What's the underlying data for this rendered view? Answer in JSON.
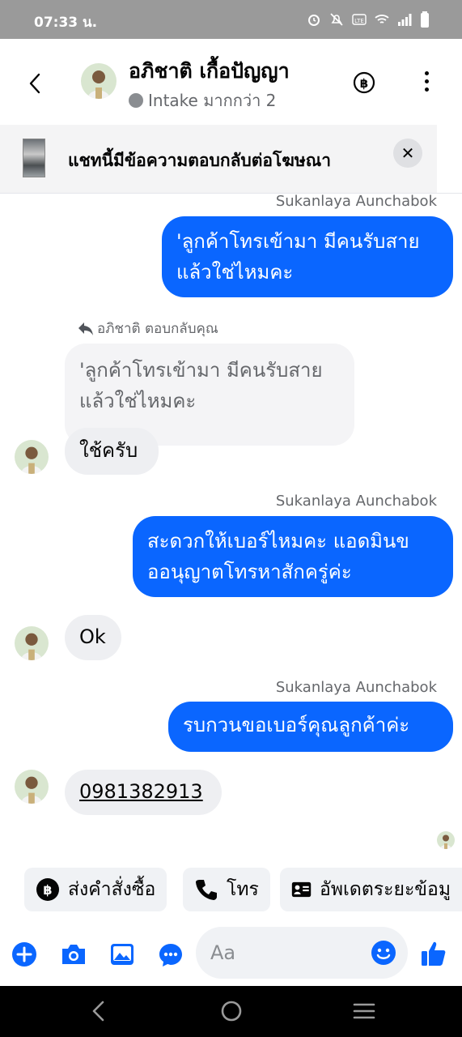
{
  "status_bar": {
    "time": "07:33 น.",
    "icons": [
      "alarm-icon",
      "mute-icon",
      "volte-icon",
      "wifi-icon",
      "signal-icon",
      "battery-icon"
    ]
  },
  "header": {
    "back_icon": "chevron-left-icon",
    "contact_name": "อภิชาติ เกื้อปัญญา",
    "status_text": "Intake มากกว่า 2",
    "payment_icon": "baht-circle-icon",
    "more_icon": "more-vertical-icon"
  },
  "ad_banner": {
    "text": "แชทนี้มีข้อความตอบกลับต่อโฆษณา",
    "close_label": "✕"
  },
  "messages": {
    "out1": {
      "sender": "Sukanlaya Aunchabok",
      "line1": "'ลูกค้าโทรเข้ามา มีคนรับสาย",
      "line2": "แล้วใช่ไหมคะ"
    },
    "reply": {
      "hint": "อภิชาติ ตอบกลับคุณ",
      "quoted_line1": "'ลูกค้าโทรเข้ามา มีคนรับสาย",
      "quoted_line2": "แล้วใช่ไหมคะ",
      "text": "ใช้ครับ"
    },
    "out2": {
      "sender": "Sukanlaya Aunchabok",
      "line1": "สะดวกให้เบอร์ไหมคะ แอดมินข",
      "line2": "ออนุญาตโทรหาสักครู่ค่ะ"
    },
    "in2": {
      "text": "Ok"
    },
    "out3": {
      "sender": "Sukanlaya Aunchabok",
      "text": "รบกวนขอเบอร์คุณลูกค้าค่ะ"
    },
    "in3": {
      "text": "0981382913"
    }
  },
  "quick_actions": [
    {
      "icon": "baht-circle-icon",
      "label": "ส่งคำสั่งซื้อ"
    },
    {
      "icon": "phone-icon",
      "label": "โทร"
    },
    {
      "icon": "contact-card-icon",
      "label": "อัพเดตระยะข้อมู"
    }
  ],
  "composer": {
    "placeholder": "Aa",
    "icons": [
      "plus-icon",
      "camera-icon",
      "gallery-icon",
      "chat-bubble-icon",
      "emoji-icon",
      "like-icon"
    ]
  },
  "nav_bar": {
    "icons": [
      "nav-back-icon",
      "nav-home-icon",
      "nav-recents-icon"
    ]
  },
  "colors": {
    "accent": "#0a66ff",
    "incoming_bubble": "#eeeff2",
    "secondary_text": "#65676b",
    "status_bar": "#9a9a9a"
  }
}
